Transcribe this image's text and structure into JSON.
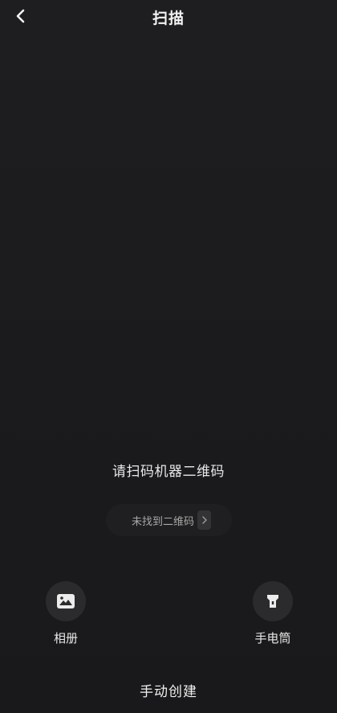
{
  "header": {
    "title": "扫描",
    "back_icon": "chevron-left-icon"
  },
  "scan": {
    "prompt": "请扫码机器二维码",
    "not_found_label": "未找到二维码",
    "not_found_icon": "chevron-right-icon"
  },
  "tools": {
    "album": {
      "label": "相册",
      "icon": "image-icon"
    },
    "flashlight": {
      "label": "手电筒",
      "icon": "flashlight-icon"
    }
  },
  "footer": {
    "manual_create_label": "手动创建"
  },
  "colors": {
    "background": "#1b1b1d",
    "tool_circle": "#2b2b2e",
    "text": "#e8e8e8",
    "muted_text": "#a8a8a8"
  }
}
